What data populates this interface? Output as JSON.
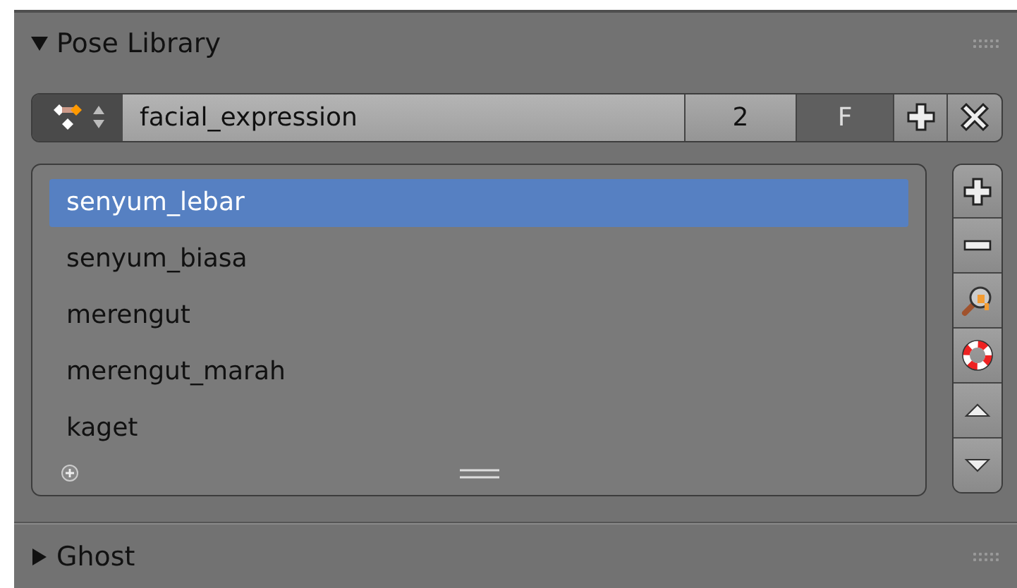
{
  "pose_library": {
    "title": "Pose Library",
    "expanded": true,
    "selector": {
      "name": "facial_expression",
      "users": "2",
      "fake_user_label": "F",
      "fake_user": false
    },
    "poses": [
      {
        "label": "senyum_lebar",
        "selected": true
      },
      {
        "label": "senyum_biasa",
        "selected": false
      },
      {
        "label": "merengut",
        "selected": false
      },
      {
        "label": "merengut_marah",
        "selected": false
      },
      {
        "label": "kaget",
        "selected": false
      }
    ]
  },
  "ghost": {
    "title": "Ghost",
    "expanded": false
  }
}
